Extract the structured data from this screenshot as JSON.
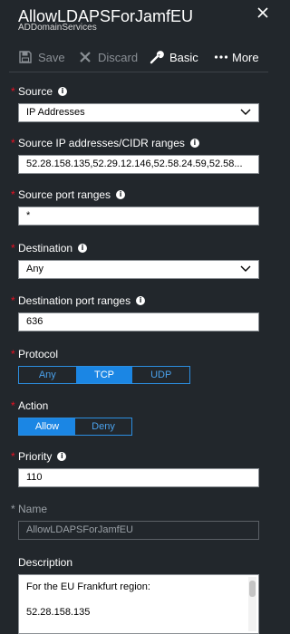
{
  "header": {
    "title": "AllowLDAPSForJamfEU",
    "subtitle": "ADDomainServices"
  },
  "toolbar": {
    "save": "Save",
    "discard": "Discard",
    "basic": "Basic",
    "more": "More"
  },
  "fields": {
    "source": {
      "label": "Source",
      "value": "IP Addresses"
    },
    "source_ip": {
      "label": "Source IP addresses/CIDR ranges",
      "value": "52.28.158.135,52.29.12.146,52.58.24.59,52.58..."
    },
    "source_port": {
      "label": "Source port ranges",
      "value": "*"
    },
    "destination": {
      "label": "Destination",
      "value": "Any"
    },
    "dest_port": {
      "label": "Destination port ranges",
      "value": "636"
    },
    "protocol": {
      "label": "Protocol",
      "options": [
        "Any",
        "TCP",
        "UDP"
      ],
      "selected": "TCP"
    },
    "action": {
      "label": "Action",
      "options": [
        "Allow",
        "Deny"
      ],
      "selected": "Allow"
    },
    "priority": {
      "label": "Priority",
      "value": "110"
    },
    "name": {
      "label": "Name",
      "value": "AllowLDAPSForJamfEU"
    },
    "description": {
      "label": "Description",
      "lines": [
        "For the EU Frankfurt region:",
        "52.28.158.135"
      ]
    }
  },
  "colors": {
    "background": "#22272c",
    "accent": "#1b86e4",
    "required": "#e81123"
  }
}
